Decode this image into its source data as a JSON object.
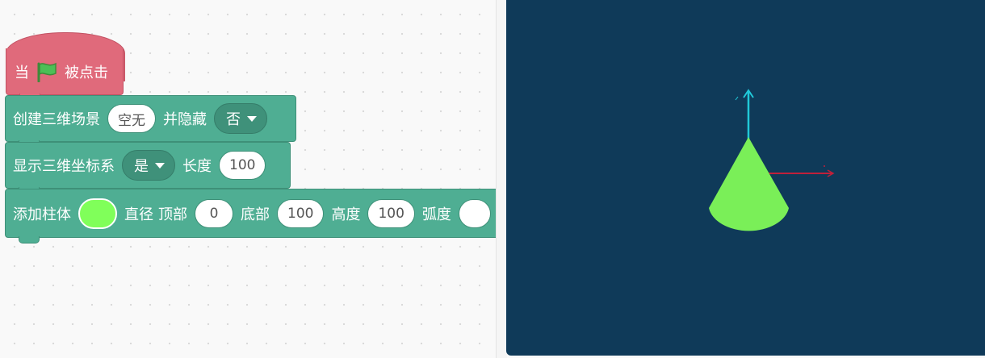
{
  "hat_block": {
    "prefix": "当",
    "flag_icon": "green-flag-icon",
    "suffix": "被点击",
    "color": "#e06a7b"
  },
  "block_scene": {
    "label": "创建三维场景",
    "value": "空无",
    "hide_label": "并隐藏",
    "hide_value": "否"
  },
  "block_axes": {
    "label": "显示三维坐标系",
    "show_value": "是",
    "length_label": "长度",
    "length_value": "100"
  },
  "block_cylinder": {
    "label": "添加柱体",
    "color_value": "#80ff5a",
    "diameter_label": "直径",
    "top_label": "顶部",
    "top_value": "0",
    "bottom_label": "底部",
    "bottom_value": "100",
    "height_label": "高度",
    "height_value": "100",
    "arc_label": "弧度"
  },
  "stage": {
    "background": "#0f3a59",
    "cone_color": "#7aef58",
    "x_axis_color": "#c0203a",
    "y_axis_color": "#20c8d8"
  },
  "colors": {
    "block_green": "#4fae93",
    "block_red": "#e06a7b"
  }
}
